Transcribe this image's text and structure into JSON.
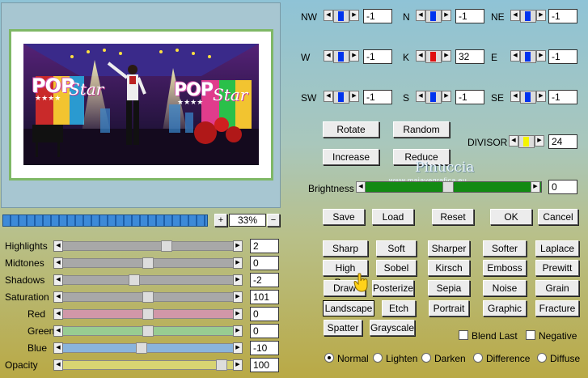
{
  "preview": {
    "pop_text": "POP",
    "star_text": "Star",
    "zoom_plus": "+",
    "zoom_minus": "−",
    "zoom_value": "33%"
  },
  "watermark": {
    "title": "Pinuccia",
    "url": "www.maiavegrafica.eu"
  },
  "sliders": [
    {
      "label": "Highlights",
      "value": "2",
      "level": 0.62,
      "color": "#a8a8a8"
    },
    {
      "label": "Midtones",
      "value": "0",
      "level": 0.5,
      "color": "#a8a8a8"
    },
    {
      "label": "Shadows",
      "value": "-2",
      "level": 0.41,
      "color": "#a8a8a8"
    },
    {
      "label": "Saturation",
      "value": "101",
      "level": 0.5,
      "color": "#a8a8a8"
    },
    {
      "label": "Red",
      "value": "0",
      "level": 0.5,
      "color": "#d197a8"
    },
    {
      "label": "Green",
      "value": "0",
      "level": 0.5,
      "color": "#98cc92"
    },
    {
      "label": "Blue",
      "value": "-10",
      "level": 0.46,
      "color": "#8ab4dc"
    },
    {
      "label": "Opacity",
      "value": "100",
      "level": 0.97,
      "color": "#d8d472"
    }
  ],
  "matrix": [
    {
      "label": "NW",
      "value": "-1",
      "thumb": "#0033ee"
    },
    {
      "label": "N",
      "value": "-1",
      "thumb": "#0033ee"
    },
    {
      "label": "NE",
      "value": "-1",
      "thumb": "#0033ee"
    },
    {
      "label": "W",
      "value": "-1",
      "thumb": "#0033ee"
    },
    {
      "label": "K",
      "value": "32",
      "thumb": "#e01010"
    },
    {
      "label": "E",
      "value": "-1",
      "thumb": "#0033ee"
    },
    {
      "label": "SW",
      "value": "-1",
      "thumb": "#0033ee"
    },
    {
      "label": "S",
      "value": "-1",
      "thumb": "#0033ee"
    },
    {
      "label": "SE",
      "value": "-1",
      "thumb": "#0033ee"
    }
  ],
  "buttons": {
    "rotate": "Rotate",
    "random": "Random",
    "increase": "Increase",
    "reduce": "Reduce",
    "save": "Save",
    "load": "Load",
    "reset": "Reset",
    "ok": "OK",
    "cancel": "Cancel"
  },
  "divisor": {
    "label": "DIVISOR",
    "value": "24"
  },
  "brightness": {
    "label": "Brightness",
    "value": "0"
  },
  "effects": [
    [
      "Sharp",
      "Soft",
      "Sharper",
      "Softer",
      "Laplace"
    ],
    [
      "High Pass",
      "Sobel",
      "Kirsch",
      "Emboss",
      "Prewitt"
    ],
    [
      "Draw",
      "Posterize",
      "Sepia",
      "Noise",
      "Grain"
    ],
    [
      "Landscape",
      "Etch",
      "Portrait",
      "Graphic",
      "Fracture"
    ],
    [
      "Spatter",
      "Grayscale"
    ]
  ],
  "checkboxes": {
    "blend_last": "Blend Last",
    "negative": "Negative"
  },
  "blend_modes": [
    "Normal",
    "Lighten",
    "Darken",
    "Difference",
    "Diffuse"
  ],
  "selected_blend_mode": "Normal",
  "selected_effect": "Landscape"
}
